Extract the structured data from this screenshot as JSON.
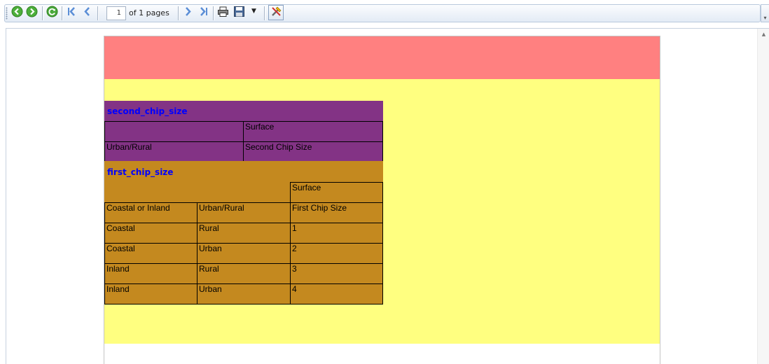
{
  "toolbar": {
    "icons": [
      "back-icon",
      "forward-icon",
      "refresh-icon",
      "first-page-icon",
      "previous-page-icon",
      "next-page-icon",
      "last-page-icon",
      "print-icon",
      "save-icon",
      "dropdown-arrow-icon",
      "tools-icon"
    ],
    "current_page": "1",
    "page_of_label": "of 1 pages"
  },
  "report": {
    "colors": {
      "header": "#ff8080",
      "body": "#ffff80",
      "second_section": "#833385",
      "first_section": "#c4891f",
      "title_text": "#0000ff"
    },
    "second_chip_size": {
      "title": "second_chip_size",
      "group_header": "Surface",
      "columns": [
        "Urban/Rural",
        "Second Chip Size"
      ]
    },
    "first_chip_size": {
      "title": "first_chip_size",
      "group_header": "Surface",
      "columns": [
        "Coastal or Inland",
        "Urban/Rural",
        "First Chip Size"
      ],
      "rows": [
        [
          "Coastal",
          "Rural",
          "1"
        ],
        [
          "Coastal",
          "Urban",
          "2"
        ],
        [
          "Inland",
          "Rural",
          "3"
        ],
        [
          "Inland",
          "Urban",
          "4"
        ]
      ]
    }
  }
}
